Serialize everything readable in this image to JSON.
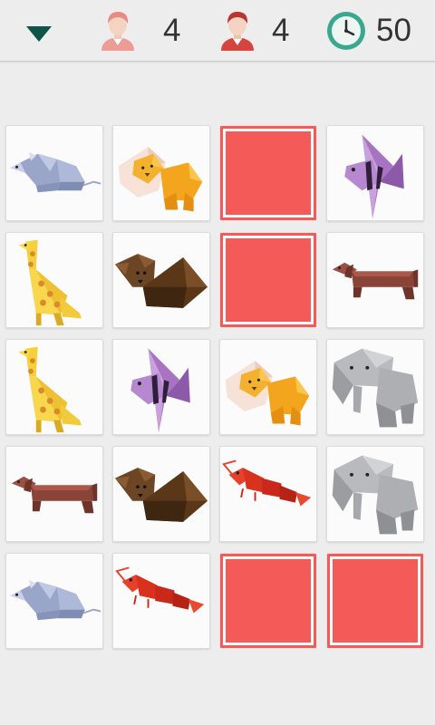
{
  "header": {
    "menu_icon": "dropdown-triangle-icon",
    "player1": {
      "icon": "player-avatar-icon",
      "color": "#e98a83",
      "score": "4"
    },
    "player2": {
      "icon": "player-avatar-icon",
      "color": "#d6453d",
      "score": "4"
    },
    "timer": {
      "icon": "clock-icon",
      "color": "#3aa88e",
      "value": "50"
    }
  },
  "colors": {
    "background": "#ededed",
    "card_face": "#fbfbfb",
    "card_back": "#f45a58"
  },
  "board": {
    "rows": 5,
    "cols": 4,
    "cards": [
      [
        "mouse",
        "lion",
        "hidden",
        "fish"
      ],
      [
        "giraffe",
        "bear",
        "hidden",
        "dachshund"
      ],
      [
        "giraffe",
        "fish",
        "lion",
        "elephant"
      ],
      [
        "dachshund",
        "bear",
        "shrimp",
        "elephant"
      ],
      [
        "mouse",
        "shrimp",
        "hidden",
        "hidden"
      ]
    ]
  }
}
